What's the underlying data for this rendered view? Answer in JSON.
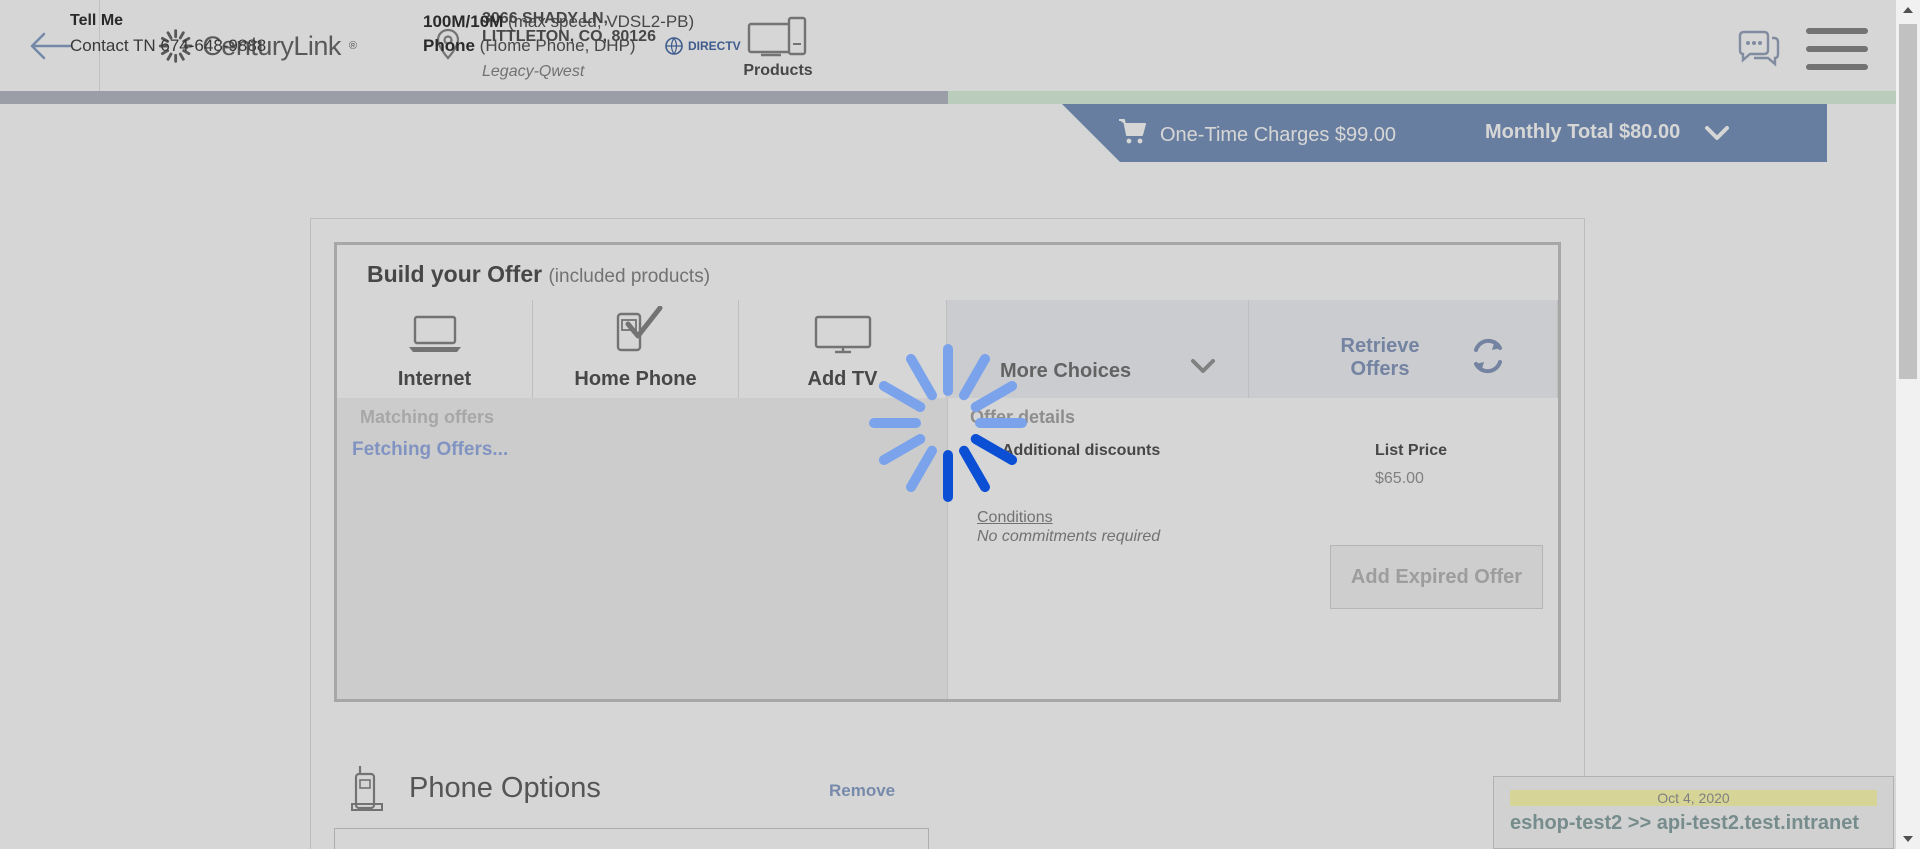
{
  "header": {
    "brand": "CenturyLink",
    "brand_tm": "®",
    "address_line1": "3066 SHADY LN,",
    "address_line2": "LITTLETON, CO, 80126",
    "address_legacy": "Legacy-Qwest",
    "products_label": "Products",
    "progress_fraction": 0.5
  },
  "summary": {
    "tellme_title": "Tell Me",
    "contact_tn": "Contact TN 674-648-9888",
    "service1_bold": "100M/10M",
    "service1_rest": " (max speed, VDSL2-PB)",
    "service2_bold": "Phone",
    "service2_rest": " (Home Phone, DHP)",
    "directv": "DIRECTV",
    "one_time_charges": "One-Time Charges $99.00",
    "monthly_total": "Monthly Total $80.00"
  },
  "offer": {
    "title": "Build your Offer",
    "title_suffix": "(included products)",
    "tabs": {
      "internet": "Internet",
      "home_phone": "Home Phone",
      "add_tv": "Add TV",
      "more_choices": "More Choices",
      "retrieve_offers": "Retrieve Offers"
    },
    "matching_offers": "Matching offers",
    "fetching": "Fetching Offers...",
    "offer_details": "Offer details",
    "additional_discounts": "Additional discounts",
    "list_price_label": "List Price",
    "list_price_value": "$65.00",
    "conditions": "Conditions",
    "no_commitments": "No commitments required",
    "add_expired_offer": "Add Expired Offer"
  },
  "phone_options": {
    "title": "Phone Options",
    "remove": "Remove"
  },
  "env": {
    "date": "Oct 4, 2020",
    "text": "eshop-test2 >> api-test2.test.intranet"
  },
  "colors": {
    "accent_blue": "#7c97bf",
    "spinner_dark": "#0b4fd4",
    "spinner_light": "#7aa3ec",
    "progress_green": "#def4df"
  }
}
